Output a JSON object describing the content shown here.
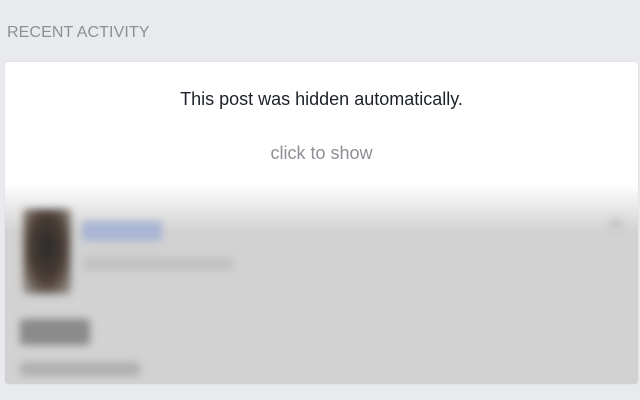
{
  "section": {
    "title": "RECENT ACTIVITY"
  },
  "hidden_post": {
    "message": "This post was hidden automatically.",
    "show_link": "click to show"
  },
  "colors": {
    "page_background": "#e9eaee",
    "card_background": "#ffffff",
    "primary_text": "#1d2129",
    "secondary_text": "#8d8f94",
    "blurred_overlay": "#d2d2d2"
  }
}
